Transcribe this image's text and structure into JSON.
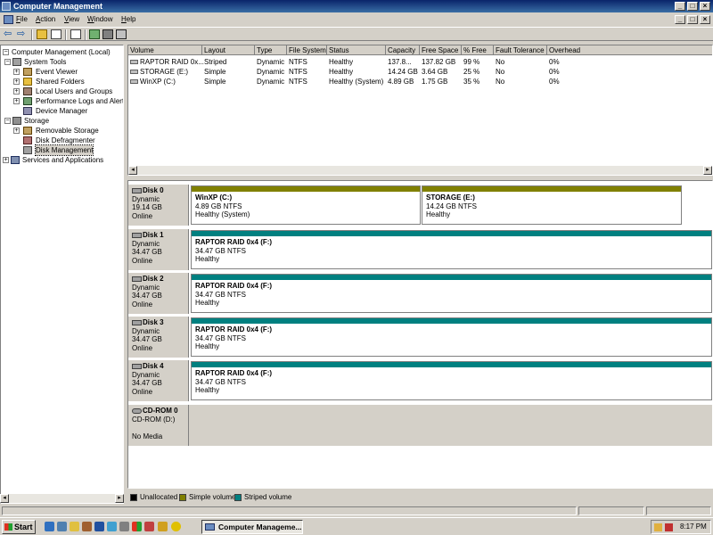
{
  "window": {
    "title": "Computer Management"
  },
  "menu": [
    {
      "label": "File",
      "key": "F",
      "rest": "ile"
    },
    {
      "label": "Action",
      "key": "A",
      "rest": "ction"
    },
    {
      "label": "View",
      "key": "V",
      "rest": "iew"
    },
    {
      "label": "Window",
      "key": "W",
      "rest": "indow"
    },
    {
      "label": "Help",
      "key": "H",
      "rest": "elp"
    }
  ],
  "tree": {
    "root": "Computer Management (Local)",
    "system_tools": "System Tools",
    "event_viewer": "Event Viewer",
    "shared_folders": "Shared Folders",
    "local_users": "Local Users and Groups",
    "perf_logs": "Performance Logs and Alerts",
    "device_manager": "Device Manager",
    "storage": "Storage",
    "removable_storage": "Removable Storage",
    "disk_defrag": "Disk Defragmenter",
    "disk_management": "Disk Management",
    "services_apps": "Services and Applications"
  },
  "volume_list": {
    "columns": [
      "Volume",
      "Layout",
      "Type",
      "File System",
      "Status",
      "Capacity",
      "Free Space",
      "% Free",
      "Fault Tolerance",
      "Overhead"
    ],
    "rows": [
      [
        "RAPTOR RAID 0x...",
        "Striped",
        "Dynamic",
        "NTFS",
        "Healthy",
        "137.8...",
        "137.82 GB",
        "99 %",
        "No",
        "0%"
      ],
      [
        "STORAGE (E:)",
        "Simple",
        "Dynamic",
        "NTFS",
        "Healthy",
        "14.24 GB",
        "3.64 GB",
        "25 %",
        "No",
        "0%"
      ],
      [
        "WinXP (C:)",
        "Simple",
        "Dynamic",
        "NTFS",
        "Healthy (System)",
        "4.89 GB",
        "1.75 GB",
        "35 %",
        "No",
        "0%"
      ]
    ]
  },
  "disks": [
    {
      "name": "Disk 0",
      "type": "Dynamic",
      "size": "19.14 GB",
      "state": "Online",
      "partitions": [
        {
          "name": "WinXP  (C:)",
          "detail": "4.89 GB NTFS",
          "status": "Healthy (System)",
          "kind": "simple"
        },
        {
          "name": "STORAGE  (E:)",
          "detail": "14.24 GB NTFS",
          "status": "Healthy",
          "kind": "simple"
        }
      ]
    },
    {
      "name": "Disk 1",
      "type": "Dynamic",
      "size": "34.47 GB",
      "state": "Online",
      "partitions": [
        {
          "name": "RAPTOR RAID 0x4  (F:)",
          "detail": "34.47 GB NTFS",
          "status": "Healthy",
          "kind": "striped"
        }
      ]
    },
    {
      "name": "Disk 2",
      "type": "Dynamic",
      "size": "34.47 GB",
      "state": "Online",
      "partitions": [
        {
          "name": "RAPTOR RAID 0x4  (F:)",
          "detail": "34.47 GB NTFS",
          "status": "Healthy",
          "kind": "striped"
        }
      ]
    },
    {
      "name": "Disk 3",
      "type": "Dynamic",
      "size": "34.47 GB",
      "state": "Online",
      "partitions": [
        {
          "name": "RAPTOR RAID 0x4  (F:)",
          "detail": "34.47 GB NTFS",
          "status": "Healthy",
          "kind": "striped"
        }
      ]
    },
    {
      "name": "Disk 4",
      "type": "Dynamic",
      "size": "34.47 GB",
      "state": "Online",
      "partitions": [
        {
          "name": "RAPTOR RAID 0x4  (F:)",
          "detail": "34.47 GB NTFS",
          "status": "Healthy",
          "kind": "striped"
        }
      ]
    }
  ],
  "cdrom": {
    "name": "CD-ROM 0",
    "drive": "CD-ROM (D:)",
    "media": "No Media"
  },
  "legend": [
    {
      "label": "Unallocated",
      "color": "#000000"
    },
    {
      "label": "Simple volume",
      "color": "#808000"
    },
    {
      "label": "Striped volume",
      "color": "#008080"
    }
  ],
  "colors": {
    "simple": "#808000",
    "striped": "#008080",
    "title_start": "#0a246a",
    "title_end": "#3a6ea5"
  },
  "taskbar": {
    "start": "Start",
    "task": "Computer Manageme...",
    "clock": "8:17 PM"
  }
}
